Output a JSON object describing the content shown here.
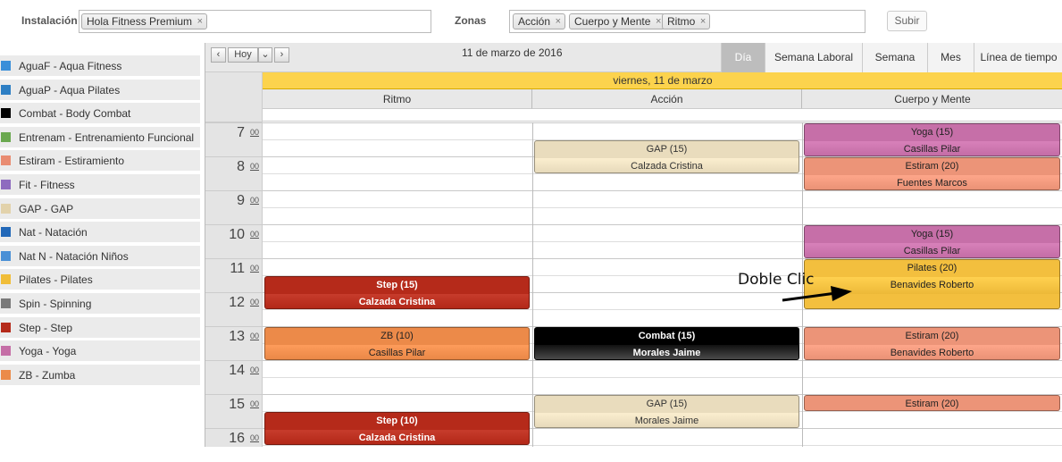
{
  "filters": {
    "installation_label": "Instalación",
    "installation_tag": "Hola Fitness Premium",
    "zones_label": "Zonas",
    "zone_tags": [
      "Acción",
      "Cuerpo y Mente",
      "Ritmo"
    ],
    "submit_label": "Subir",
    "remove_icon": "×"
  },
  "legend": [
    {
      "label": "AguaF - Aqua Fitness",
      "color": "#3a8fd9"
    },
    {
      "label": "AguaP - Aqua Pilates",
      "color": "#2e7fc4"
    },
    {
      "label": "Combat - Body Combat",
      "color": "#000000"
    },
    {
      "label": "Entrenam - Entrenamiento Funcional",
      "color": "#6aa84f"
    },
    {
      "label": "Estiram - Estiramiento",
      "color": "#e98c72"
    },
    {
      "label": "Fit - Fitness",
      "color": "#8e6bbf"
    },
    {
      "label": "GAP - GAP",
      "color": "#e2d2ab"
    },
    {
      "label": "Nat - Natación",
      "color": "#2268b8"
    },
    {
      "label": "Nat N - Natación Niños",
      "color": "#4a90d6"
    },
    {
      "label": "Pilates - Pilates",
      "color": "#f0bd38"
    },
    {
      "label": "Spin - Spinning",
      "color": "#7a7a7a"
    },
    {
      "label": "Step - Step",
      "color": "#b52a1a"
    },
    {
      "label": "Yoga - Yoga",
      "color": "#c56ea6"
    },
    {
      "label": "ZB - Zumba",
      "color": "#eb8b4a"
    }
  ],
  "nav": {
    "prev": "‹",
    "today": "Hoy",
    "dropdown": "⌄",
    "next": "›",
    "date": "11 de marzo de 2016",
    "views": [
      "Día",
      "Semana Laboral",
      "Semana",
      "Mes",
      "Línea de tiempo"
    ],
    "active_view": "Día"
  },
  "day_header": "viernes, 11 de marzo",
  "columns": [
    "Ritmo",
    "Acción",
    "Cuerpo y Mente"
  ],
  "hours": [
    {
      "h": "7",
      "m": "00"
    },
    {
      "h": "8",
      "m": "00"
    },
    {
      "h": "9",
      "m": "00"
    },
    {
      "h": "10",
      "m": "00"
    },
    {
      "h": "11",
      "m": "00"
    },
    {
      "h": "12",
      "m": "00"
    },
    {
      "h": "13",
      "m": "00"
    },
    {
      "h": "14",
      "m": "00"
    },
    {
      "h": "15",
      "m": "00"
    },
    {
      "h": "16",
      "m": "00"
    }
  ],
  "events": [
    {
      "col": 1,
      "start": 7.5,
      "end": 8.5,
      "title": "GAP (15)",
      "instructor": "Calzada Cristina",
      "color": "#e9dcbd",
      "text": "#333",
      "bold": false
    },
    {
      "col": 2,
      "start": 7.0,
      "end": 8.0,
      "title": "Yoga (15)",
      "instructor": "Casillas Pilar",
      "color": "#c66fa8",
      "text": "#222",
      "bold": false
    },
    {
      "col": 2,
      "start": 8.0,
      "end": 9.0,
      "title": "Estiram (20)",
      "instructor": "Fuentes Marcos",
      "color": "#ec9478",
      "text": "#222",
      "bold": false
    },
    {
      "col": 2,
      "start": 10.0,
      "end": 11.0,
      "title": "Yoga (15)",
      "instructor": "Casillas Pilar",
      "color": "#c66fa8",
      "text": "#222",
      "bold": false
    },
    {
      "col": 2,
      "start": 11.0,
      "end": 12.5,
      "title": "Pilates (20)",
      "instructor": "Benavides Roberto",
      "color": "#f3bf3e",
      "text": "#222",
      "bold": false
    },
    {
      "col": 0,
      "start": 11.5,
      "end": 12.5,
      "title": "Step (15)",
      "instructor": "Calzada Cristina",
      "color": "#b52a1a",
      "text": "#fff",
      "bold": true
    },
    {
      "col": 0,
      "start": 13.0,
      "end": 14.0,
      "title": "ZB (10)",
      "instructor": "Casillas Pilar",
      "color": "#ec8a49",
      "text": "#222",
      "bold": false
    },
    {
      "col": 1,
      "start": 13.0,
      "end": 14.0,
      "title": "Combat (15)",
      "instructor": "Morales Jaime",
      "color": "#000000",
      "text": "#fff",
      "bold": true
    },
    {
      "col": 2,
      "start": 13.0,
      "end": 14.0,
      "title": "Estiram (20)",
      "instructor": "Benavides Roberto",
      "color": "#ec9478",
      "text": "#222",
      "bold": false
    },
    {
      "col": 1,
      "start": 15.0,
      "end": 16.0,
      "title": "GAP (15)",
      "instructor": "Morales Jaime",
      "color": "#e9dcbd",
      "text": "#333",
      "bold": false
    },
    {
      "col": 2,
      "start": 15.0,
      "end": 15.5,
      "title": "Estiram (20)",
      "instructor": "",
      "color": "#ec9478",
      "text": "#222",
      "bold": false
    },
    {
      "col": 0,
      "start": 15.5,
      "end": 16.5,
      "title": "Step (10)",
      "instructor": "Calzada Cristina",
      "color": "#b52a1a",
      "text": "#fff",
      "bold": true
    }
  ],
  "annotation": "Doble Clic"
}
